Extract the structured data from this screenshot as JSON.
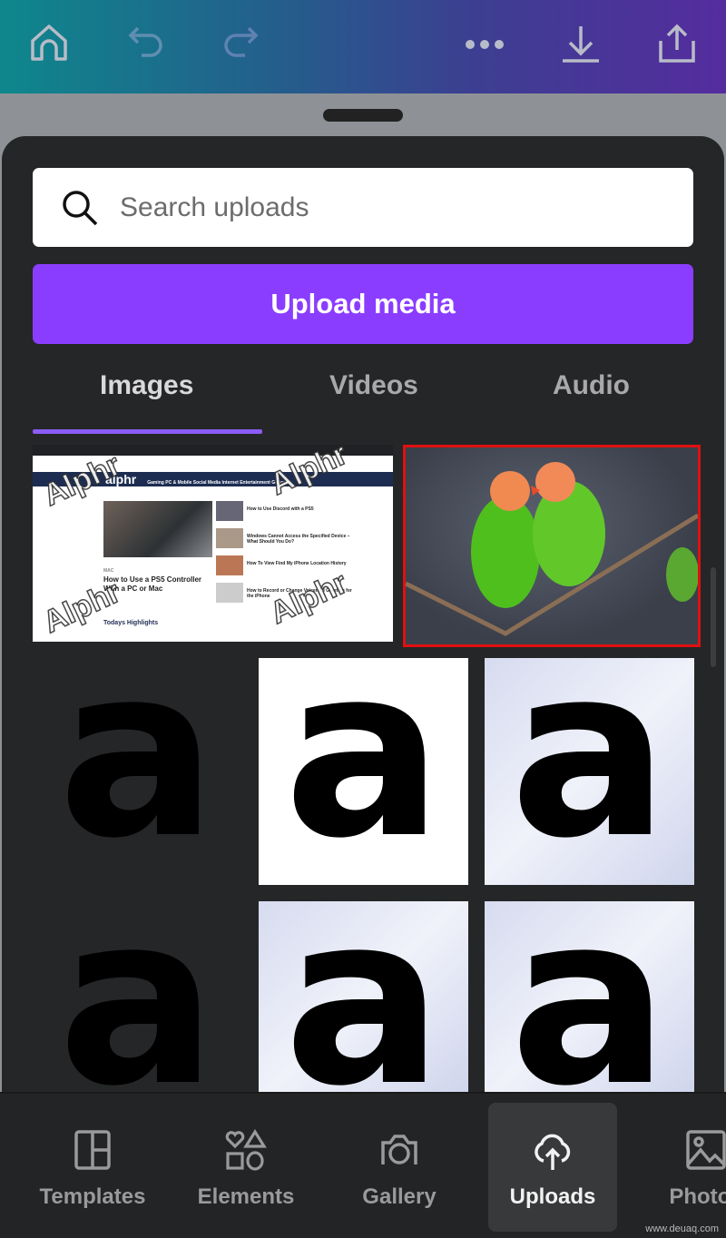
{
  "topbar": {
    "icons": [
      "home-icon",
      "undo-icon",
      "redo-icon",
      "more-icon",
      "download-icon",
      "share-icon"
    ],
    "gradient": [
      "#0e878c",
      "#552c9e"
    ]
  },
  "search": {
    "placeholder": "Search uploads",
    "value": ""
  },
  "upload_button": {
    "label": "Upload media",
    "color": "#8b3dff"
  },
  "tabs": [
    {
      "label": "Images",
      "active": true
    },
    {
      "label": "Videos",
      "active": false
    },
    {
      "label": "Audio",
      "active": false
    }
  ],
  "uploads": {
    "screenshot": {
      "nav_logo": "alphr",
      "nav_items": "Gaming  PC & Mobile  Social Media  Internet  Entertainment  Gadgets",
      "category": "MAC",
      "headline": "How to Use a PS5 Controller With a PC or Mac",
      "side_articles": [
        "How to Use Discord with a PS5",
        "Windows Cannot Access the Specified Device – What Should You Do?",
        "How To View Find My iPhone Location History",
        "How to Record or Change Voicemail Greeting for the iPhone"
      ],
      "section": "Todays Highlights",
      "watermark": "Alphr"
    },
    "photo": {
      "selected": true,
      "selection_color": "#e01010"
    },
    "letter_tiles": [
      "a",
      "a",
      "a",
      "a",
      "a",
      "a"
    ]
  },
  "bottom_nav": [
    {
      "label": "Templates",
      "icon": "templates-icon",
      "active": false
    },
    {
      "label": "Elements",
      "icon": "elements-icon",
      "active": false
    },
    {
      "label": "Gallery",
      "icon": "camera-icon",
      "active": false
    },
    {
      "label": "Uploads",
      "icon": "cloud-upload-icon",
      "active": true
    },
    {
      "label": "Photos",
      "icon": "photo-icon",
      "active": false
    }
  ],
  "watermark": "www.deuaq.com"
}
